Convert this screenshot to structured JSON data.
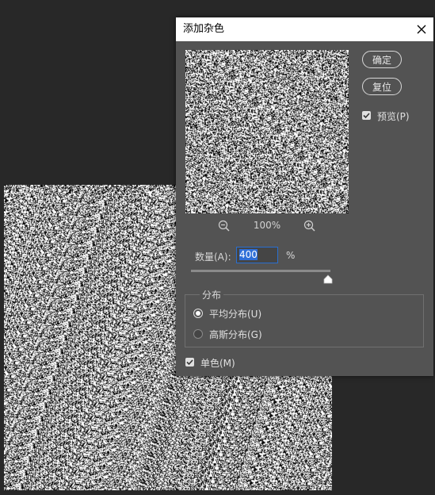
{
  "dialog": {
    "title": "添加杂色",
    "ok_label": "确定",
    "reset_label": "复位",
    "preview_label": "预览(P)",
    "preview_checked": true,
    "zoom_level": "100%",
    "amount_label": "数量(A):",
    "amount_value": "400",
    "amount_unit": "%",
    "distribution_label": "分布",
    "distribution_options": [
      {
        "label": "平均分布(U)",
        "selected": true
      },
      {
        "label": "高斯分布(G)",
        "selected": false
      }
    ],
    "monochromatic_label": "单色(M)",
    "monochromatic_checked": true
  },
  "icons": {
    "close": "close-icon",
    "zoom_out": "zoom-out-icon",
    "zoom_in": "zoom-in-icon",
    "check": "checkmark-icon",
    "slider": "slider-thumb-icon"
  },
  "colors": {
    "workspace_bg": "#282828",
    "dialog_bg": "#535353",
    "titlebar_bg": "#ffffff",
    "input_focus": "#2a6fd0",
    "noise_light": "#ffffff",
    "noise_dark": "#000000"
  }
}
